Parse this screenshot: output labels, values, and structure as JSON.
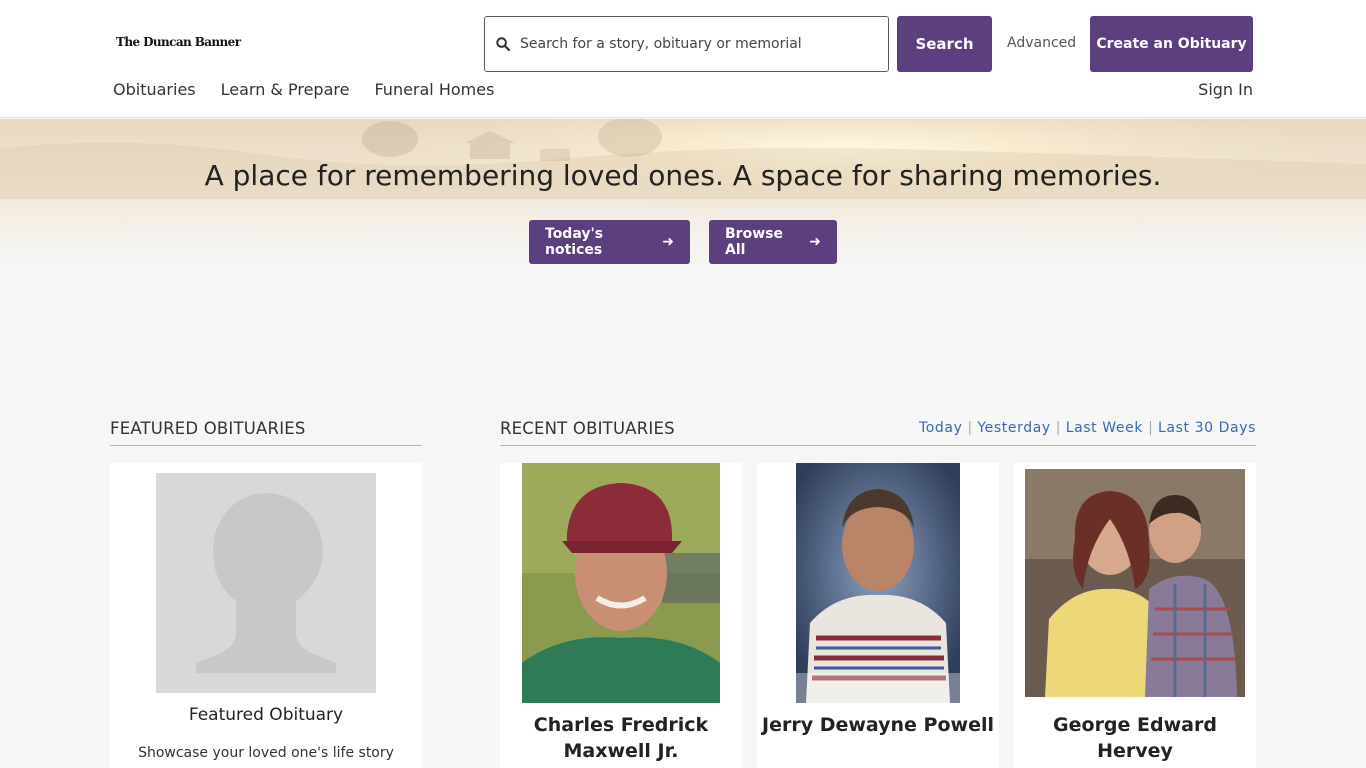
{
  "header": {
    "logo": "The Duncan Banner",
    "search_placeholder": "Search for a story, obituary or memorial",
    "search_button": "Search",
    "advanced_link": "Advanced",
    "create_button": "Create an Obituary",
    "nav": [
      "Obituaries",
      "Learn & Prepare",
      "Funeral Homes"
    ],
    "sign_in": "Sign In"
  },
  "hero": {
    "title": "A place for remembering loved ones. A space for sharing memories.",
    "todays_button": "Today's notices",
    "browse_button": "Browse All"
  },
  "featured": {
    "heading": "FEATURED OBITUARIES",
    "card_title": "Featured Obituary",
    "card_text": "Showcase your loved one's life story"
  },
  "recent": {
    "heading": "RECENT OBITUARIES",
    "filters": [
      "Today",
      "Yesterday",
      "Last Week",
      "Last 30 Days"
    ],
    "obituaries": [
      {
        "name_line1": "Charles Fredrick",
        "name_line2": "Maxwell Jr."
      },
      {
        "name_line1": "Jerry Dewayne Powell",
        "name_line2": ""
      },
      {
        "name_line1": "George Edward",
        "name_line2": "Hervey"
      }
    ]
  },
  "colors": {
    "primary_purple": "#5c3f7f",
    "link_blue": "#3a68b4",
    "page_background": "#f6f6f6"
  },
  "icons": {
    "search": "search-icon",
    "arrow": "arrow-right-icon"
  }
}
